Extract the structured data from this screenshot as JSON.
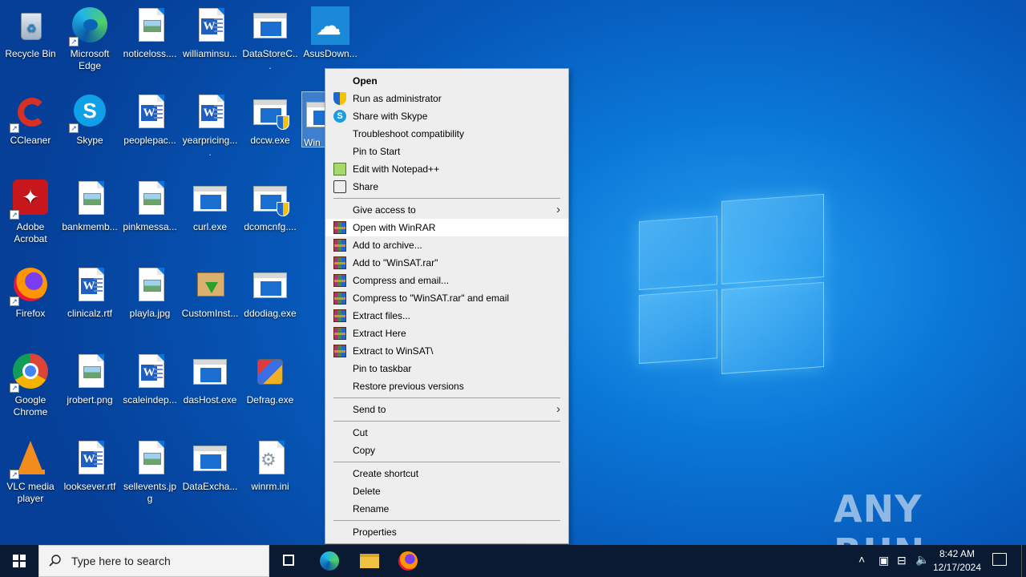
{
  "desktop": {
    "icons": [
      {
        "label": "Recycle Bin"
      },
      {
        "label": "Microsoft Edge"
      },
      {
        "label": "noticeloss...."
      },
      {
        "label": "williaminsu..."
      },
      {
        "label": "DataStoreC..."
      },
      {
        "label": "AsusDown..."
      },
      {
        "label": "CCleaner"
      },
      {
        "label": "Skype"
      },
      {
        "label": "peoplepac..."
      },
      {
        "label": "yearpricing...."
      },
      {
        "label": "dccw.exe"
      },
      {
        "label": "WinS"
      },
      {
        "label": "Adobe Acrobat"
      },
      {
        "label": "bankmemb..."
      },
      {
        "label": "pinkmessa..."
      },
      {
        "label": "curl.exe"
      },
      {
        "label": "dcomcnfg...."
      },
      {
        "label": "Firefox"
      },
      {
        "label": "clinicalz.rtf"
      },
      {
        "label": "playla.jpg"
      },
      {
        "label": "CustomInst..."
      },
      {
        "label": "ddodiag.exe"
      },
      {
        "label": "Google Chrome"
      },
      {
        "label": "jrobert.png"
      },
      {
        "label": "scaleindep..."
      },
      {
        "label": "dasHost.exe"
      },
      {
        "label": "Defrag.exe"
      },
      {
        "label": "VLC media player"
      },
      {
        "label": "looksever.rtf"
      },
      {
        "label": "sellevents.jpg"
      },
      {
        "label": "DataExcha..."
      },
      {
        "label": "winrm.ini"
      }
    ]
  },
  "context_menu": {
    "items": [
      {
        "label": "Open"
      },
      {
        "label": "Run as administrator"
      },
      {
        "label": "Share with Skype"
      },
      {
        "label": "Troubleshoot compatibility"
      },
      {
        "label": "Pin to Start"
      },
      {
        "label": "Edit with Notepad++"
      },
      {
        "label": "Share"
      },
      {
        "label": "Give access to"
      },
      {
        "label": "Open with WinRAR"
      },
      {
        "label": "Add to archive..."
      },
      {
        "label": "Add to \"WinSAT.rar\""
      },
      {
        "label": "Compress and email..."
      },
      {
        "label": "Compress to \"WinSAT.rar\" and email"
      },
      {
        "label": "Extract files..."
      },
      {
        "label": "Extract Here"
      },
      {
        "label": "Extract to WinSAT\\"
      },
      {
        "label": "Pin to taskbar"
      },
      {
        "label": "Restore previous versions"
      },
      {
        "label": "Send to"
      },
      {
        "label": "Cut"
      },
      {
        "label": "Copy"
      },
      {
        "label": "Create shortcut"
      },
      {
        "label": "Delete"
      },
      {
        "label": "Rename"
      },
      {
        "label": "Properties"
      }
    ],
    "highlighted_item": "Open with WinRAR"
  },
  "taskbar": {
    "search_placeholder": "Type here to search",
    "time": "8:42 AM",
    "date": "12/17/2024",
    "tray_icons": [
      "chevron-up-icon",
      "meet-now-icon",
      "network-icon",
      "volume-icon"
    ],
    "pinned": [
      "task-view-icon",
      "edge-icon",
      "file-explorer-icon",
      "firefox-icon"
    ]
  },
  "watermark": {
    "text": "ANY RUN"
  },
  "colors": {
    "taskbar": "#0a1a33",
    "menu_bg": "#eeeeee",
    "menu_highlight": "#ffffff",
    "desktop_blue": "#0657b8"
  }
}
